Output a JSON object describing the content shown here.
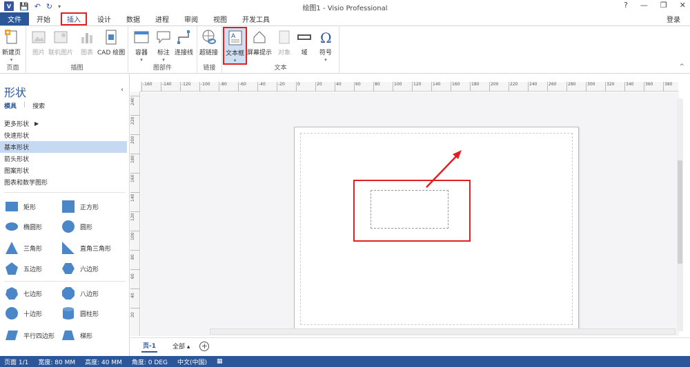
{
  "window": {
    "app_badge": "V",
    "title": "绘图1 - Visio Professional",
    "controls": [
      "?",
      "—",
      "❐",
      "✕"
    ]
  },
  "qat": {
    "save": "💾",
    "undo": "↶",
    "redo": "↻",
    "more": "▾"
  },
  "tabs": [
    {
      "label": "文件"
    },
    {
      "label": "开始"
    },
    {
      "label": "插入"
    },
    {
      "label": "设计"
    },
    {
      "label": "数据"
    },
    {
      "label": "进程"
    },
    {
      "label": "审阅"
    },
    {
      "label": "视图"
    },
    {
      "label": "开发工具"
    }
  ],
  "login": "登录",
  "ribbon": {
    "groups": {
      "page": "页面",
      "illustrations": "插图",
      "diagram_parts": "图部件",
      "links": "链接",
      "text": "文本"
    },
    "buttons": {
      "new_page": "新建页",
      "picture": "图片",
      "online_picture": "联机图片",
      "chart": "图表",
      "cad": "CAD 绘图",
      "container": "容器",
      "callout": "标注",
      "connector": "连接线",
      "hyperlink": "超链接",
      "textbox": "文本框",
      "screentip": "屏幕提示",
      "object": "对象",
      "field": "域",
      "symbol": "符号"
    }
  },
  "pane": {
    "title": "形状",
    "tab_stencil": "模具",
    "tab_search": "搜索",
    "more_shapes": "更多形状",
    "stencils": [
      "快速形状",
      "基本形状",
      "箭头形状",
      "图案形状",
      "图表和数学图形"
    ],
    "shapes": [
      {
        "label": "矩形"
      },
      {
        "label": "正方形"
      },
      {
        "label": "椭圆形"
      },
      {
        "label": "圆形"
      },
      {
        "label": "三角形"
      },
      {
        "label": "直角三角形"
      },
      {
        "label": "五边形"
      },
      {
        "label": "六边形"
      },
      {
        "label": "七边形"
      },
      {
        "label": "八边形"
      },
      {
        "label": "十边形"
      },
      {
        "label": "圆柱形"
      },
      {
        "label": "平行四边形"
      },
      {
        "label": "梯形"
      }
    ]
  },
  "ruler": {
    "h": [
      "-160",
      "-140",
      "-120",
      "-100",
      "-80",
      "-60",
      "-40",
      "-20",
      "0",
      "20",
      "40",
      "60",
      "80",
      "100",
      "120",
      "140",
      "160",
      "180",
      "200",
      "220",
      "240",
      "260",
      "280",
      "300",
      "320",
      "340",
      "360",
      "380"
    ],
    "v": [
      "240",
      "220",
      "200",
      "180",
      "160",
      "140",
      "120",
      "100",
      "80",
      "60",
      "40",
      "20"
    ]
  },
  "page_tabs": {
    "page1": "页-1",
    "all": "全部 ▴",
    "add": "+"
  },
  "status": {
    "page": "页面 1/1",
    "width": "宽度: 80 MM",
    "height": "高度: 40 MM",
    "angle": "角度: 0 DEG",
    "lang": "中文(中国)"
  },
  "colors": {
    "accent": "#2b579a",
    "highlight": "#e02020",
    "shape_fill": "#4a86c8"
  }
}
